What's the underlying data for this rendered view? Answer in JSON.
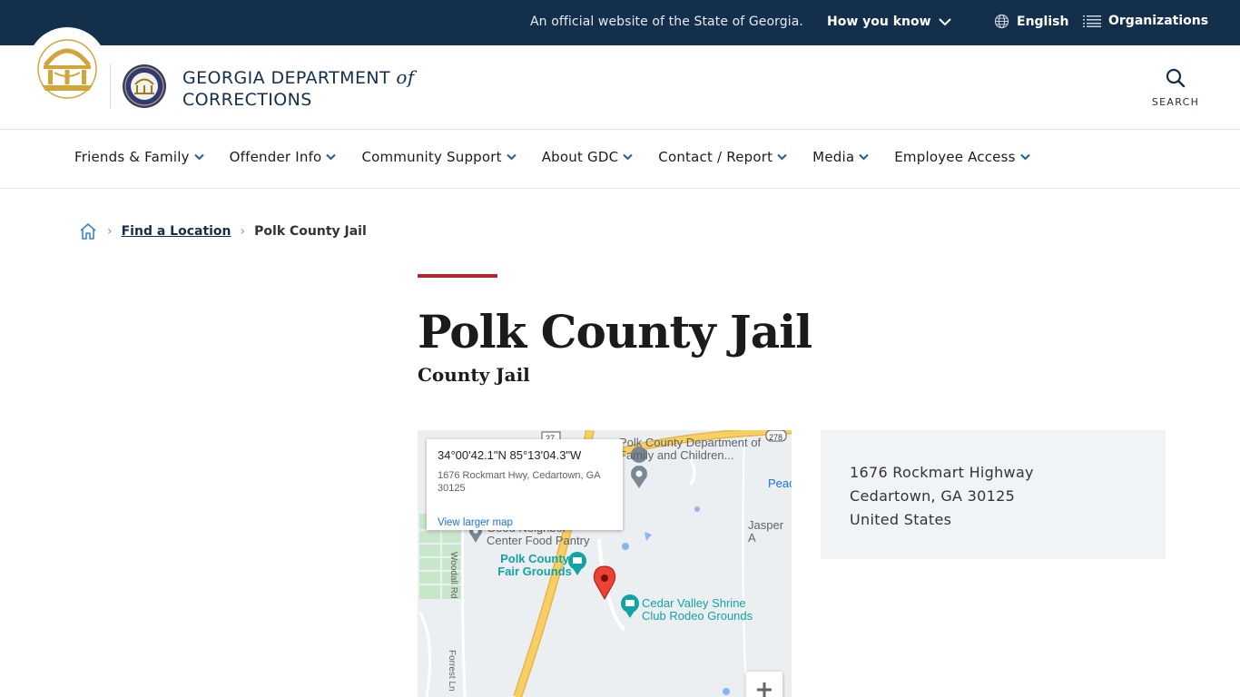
{
  "topbar": {
    "official_text": "An official website of the State of Georgia.",
    "how_you_know": "How you know",
    "language": "English",
    "organizations": "Organizations"
  },
  "header": {
    "brand_line1": "GEORGIA DEPARTMENT",
    "brand_of": "of",
    "brand_line2": "CORRECTIONS",
    "search_label": "SEARCH"
  },
  "nav": {
    "items": [
      {
        "label": "Friends & Family"
      },
      {
        "label": "Offender Info"
      },
      {
        "label": "Community Support"
      },
      {
        "label": "About GDC"
      },
      {
        "label": "Contact / Report"
      },
      {
        "label": "Media"
      },
      {
        "label": "Employee Access"
      }
    ]
  },
  "breadcrumb": {
    "link": "Find a Location",
    "current": "Polk County Jail"
  },
  "page": {
    "title": "Polk County Jail",
    "subtitle": "County Jail"
  },
  "map": {
    "popup_coords": "34°00'42.1\"N 85°13'04.3\"W",
    "popup_address": "1676 Rockmart Hwy, Cedartown, GA 30125",
    "popup_link": "View larger map",
    "labels": {
      "dfcs": "Polk County Department of Family and Children...",
      "pantry": "Good Neighbor Center Food Pantry",
      "fairgrounds": "Polk County Fair Grounds",
      "shrine": "Cedar Valley Shrine Club Rodeo Grounds",
      "jasper": "Jasper A",
      "peac": "Peac",
      "woodall": "Woodall Rd",
      "forrest": "Forrest Ln",
      "route27": "27",
      "route278": "278"
    }
  },
  "address": {
    "line1": "1676 Rockmart Highway",
    "line2": "Cedartown, GA 30125",
    "line3": "United States"
  },
  "colors": {
    "topbar_bg": "#132f4c",
    "accent_red": "#b2262d",
    "link_blue": "#1a73e8",
    "map_road_yellow": "#f6cf65"
  }
}
